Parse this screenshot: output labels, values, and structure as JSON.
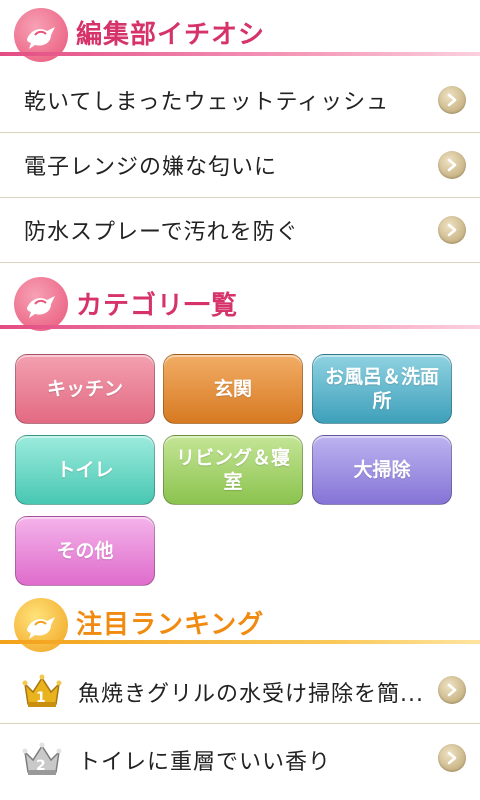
{
  "colors": {
    "pink_accent": "#d5336a",
    "orange_accent": "#f08a10",
    "divider": "#d9d3bf"
  },
  "featured": {
    "title": "編集部イチオシ",
    "icon": "bird-icon",
    "items": [
      {
        "label": "乾いてしまったウェットティッシュ"
      },
      {
        "label": "電子レンジの嫌な匂いに"
      },
      {
        "label": "防水スプレーで汚れを防ぐ"
      }
    ]
  },
  "categories": {
    "title": "カテゴリ一覧",
    "icon": "bird-icon",
    "items": [
      {
        "label": "キッチン",
        "color": "#ec8095"
      },
      {
        "label": "玄関",
        "color": "#e88e3a"
      },
      {
        "label": "お風呂＆洗面所",
        "color": "#5cb6cb"
      },
      {
        "label": "トイレ",
        "color": "#6ed9c8"
      },
      {
        "label": "リビング＆寝室",
        "color": "#a8d46c"
      },
      {
        "label": "大掃除",
        "color": "#9d8fe0"
      },
      {
        "label": "その他",
        "color": "#ec8ad8"
      }
    ]
  },
  "ranking": {
    "title": "注目ランキング",
    "icon": "bird-icon",
    "items": [
      {
        "rank": "1",
        "label": "魚焼きグリルの水受け掃除を簡...",
        "crown": "gold-crown-icon"
      },
      {
        "rank": "2",
        "label": "トイレに重層でいい香り",
        "crown": "silver-crown-icon"
      }
    ]
  }
}
